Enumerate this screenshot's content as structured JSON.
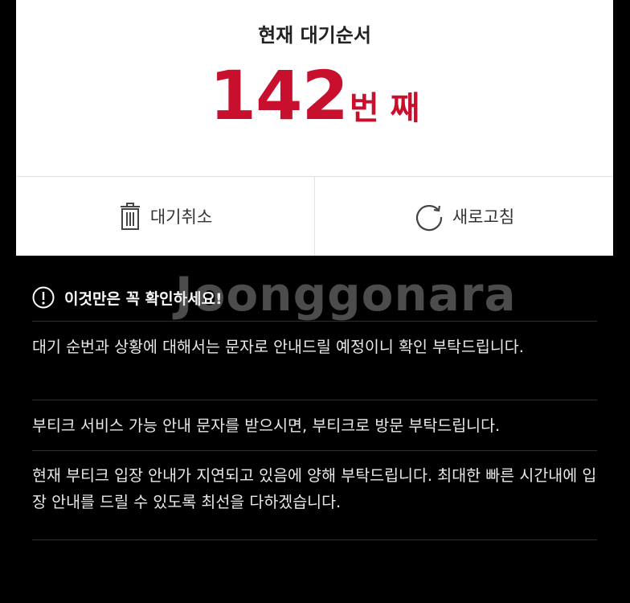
{
  "queue": {
    "label": "현재 대기순서",
    "number": "142",
    "unit": "번 째"
  },
  "actions": {
    "cancel_label": "대기취소",
    "refresh_label": "새로고침"
  },
  "notice": {
    "heading": "이것만은 꼭 확인하세요!",
    "items": [
      "대기 순번과 상황에 대해서는 문자로 안내드릴 예정이니 확인 부탁드립니다.",
      "부티크 서비스 가능 안내 문자를 받으시면, 부티크로 방문 부탁드립니다.",
      "현재 부티크 입장 안내가 지연되고 있음에 양해 부탁드립니다. 최대한 빠른 시간내에 입장 안내를 드릴 수 있도록 최선을 다하겠습니다."
    ]
  },
  "watermark": "Joonggonara",
  "colors": {
    "accent": "#c8102e",
    "background": "#000000",
    "card": "#ffffff"
  },
  "icons": {
    "cancel": "trash-icon",
    "refresh": "refresh-icon",
    "notice": "exclamation-circle-icon"
  }
}
